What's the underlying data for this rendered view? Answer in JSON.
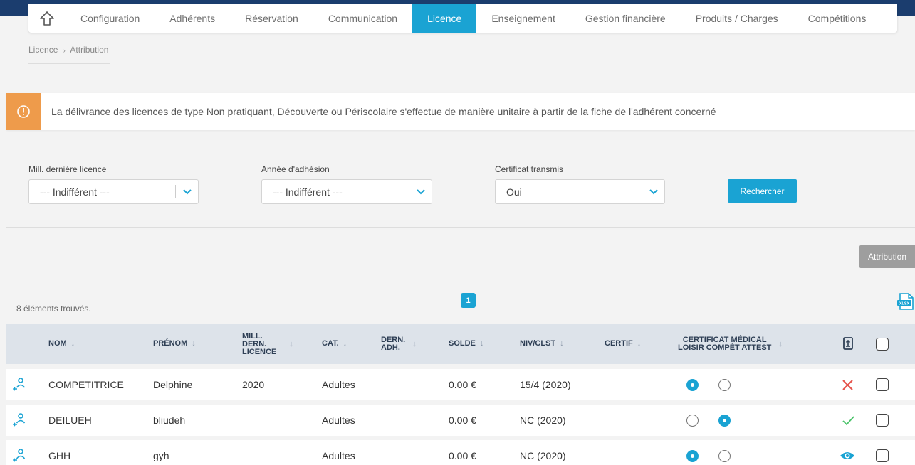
{
  "nav": {
    "items": [
      {
        "label": "Configuration",
        "active": false
      },
      {
        "label": "Adhérents",
        "active": false
      },
      {
        "label": "Réservation",
        "active": false
      },
      {
        "label": "Communication",
        "active": false
      },
      {
        "label": "Licence",
        "active": true
      },
      {
        "label": "Enseignement",
        "active": false
      },
      {
        "label": "Gestion financière",
        "active": false
      },
      {
        "label": "Produits / Charges",
        "active": false
      },
      {
        "label": "Compétitions",
        "active": false
      }
    ]
  },
  "breadcrumb": {
    "parent": "Licence",
    "separator": "›",
    "current": "Attribution"
  },
  "alert": {
    "text": "La délivrance des licences de type Non pratiquant, Découverte ou Périscolaire s'effectue de manière unitaire à partir de la fiche de l'adhérent concerné"
  },
  "filters": {
    "last_license": {
      "label": "Mill. dernière licence",
      "value": "--- Indifférent ---"
    },
    "membership_year": {
      "label": "Année d'adhésion",
      "value": "--- Indifférent ---"
    },
    "certificate": {
      "label": "Certificat transmis",
      "value": "Oui"
    },
    "search_button": "Rechercher"
  },
  "attribution_button": "Attribution",
  "results": {
    "count_text": "8 éléments trouvés.",
    "page": "1"
  },
  "table": {
    "headers": {
      "nom": "NOM",
      "prenom": "PRÉNOM",
      "mill_l1": "MILL.",
      "mill_l2": "DERN.",
      "mill_l3": "LICENCE",
      "cat": "CAT.",
      "dern_l1": "DERN.",
      "dern_l2": "ADH.",
      "solde": "SOLDE",
      "niv": "NIV/CLST",
      "certif": "CERTIF",
      "cm_l1": "CERTIFICAT MÉDICAL",
      "cm_l2": "LOISIR COMPÉT ATTEST",
      "sort_arrow": "↓"
    },
    "rows": [
      {
        "nom": "COMPETITRICE",
        "prenom": "Delphine",
        "mill": "2020",
        "cat": "Adultes",
        "dern": "",
        "solde": "0.00 €",
        "niv": "15/4 (2020)",
        "certif": "",
        "loisir": true,
        "compet": false,
        "status": "cross"
      },
      {
        "nom": "DEILUEH",
        "prenom": "bliudeh",
        "mill": "",
        "cat": "Adultes",
        "dern": "",
        "solde": "0.00 €",
        "niv": "NC (2020)",
        "certif": "",
        "loisir": false,
        "compet": true,
        "status": "check"
      },
      {
        "nom": "GHH",
        "prenom": "gyh",
        "mill": "",
        "cat": "Adultes",
        "dern": "",
        "solde": "0.00 €",
        "niv": "NC (2020)",
        "certif": "",
        "loisir": true,
        "compet": false,
        "status": "eye"
      }
    ]
  },
  "colors": {
    "accent": "#1aa3d3",
    "alert": "#ee9b4b",
    "navbar": "#1b3d6e",
    "header_bg": "#dde3ea",
    "cross": "#e5534b",
    "check": "#4cc46b",
    "button_grey": "#9e9e9e"
  }
}
